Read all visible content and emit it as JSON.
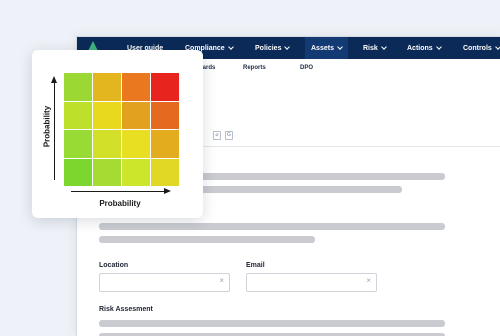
{
  "nav": {
    "items": [
      {
        "label": "User guide",
        "dropdown": false
      },
      {
        "label": "Compliance",
        "dropdown": true
      },
      {
        "label": "Policies",
        "dropdown": true
      },
      {
        "label": "Assets",
        "dropdown": true,
        "active": true
      },
      {
        "label": "Risk",
        "dropdown": true
      },
      {
        "label": "Actions",
        "dropdown": true
      },
      {
        "label": "Controls",
        "dropdown": true
      }
    ],
    "subitems": [
      "oards",
      "Reports",
      "DPO"
    ]
  },
  "toolbar": {
    "icon_glyph": "G"
  },
  "form": {
    "location_label": "Location",
    "location_value": "",
    "email_label": "Email",
    "email_value": "",
    "risk_label": "Risk Assesment",
    "clear_glyph": "×"
  },
  "matrix": {
    "y_label": "Probability",
    "x_label": "Probability",
    "colors": [
      [
        "#9bd834",
        "#e3b51f",
        "#e9781f",
        "#e8241f"
      ],
      [
        "#bde02a",
        "#e8d91f",
        "#e2a11f",
        "#e36a1f"
      ],
      [
        "#98db35",
        "#d3e02a",
        "#e8df22",
        "#e3ac1f"
      ],
      [
        "#7bd62e",
        "#a5dc33",
        "#cce72b",
        "#e0d825"
      ]
    ]
  },
  "colors": {
    "nav_bg": "#0b2a57",
    "accent": "#3fb47c"
  }
}
